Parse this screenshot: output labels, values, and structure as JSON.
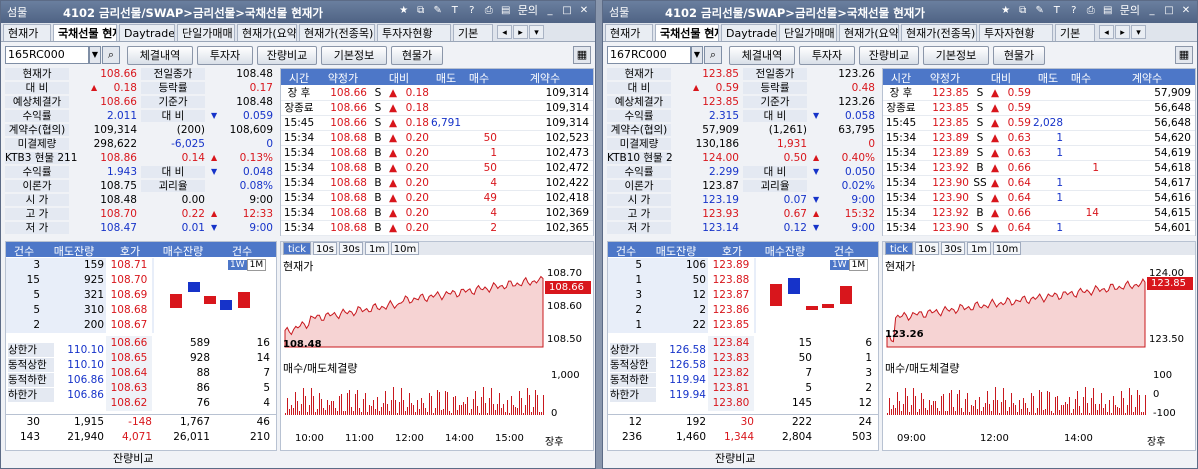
{
  "windows": [
    {
      "title": "4102 금리선물/SWAP>금리선물>국채선물 현재가",
      "logo": "섬물",
      "menu": "문의",
      "tabs": [
        "현재가",
        "국채선물 현재가",
        "Daytrade",
        "단일가매매",
        "현재가(요약)",
        "현재가(전종목)",
        "투자자현황",
        "기본"
      ],
      "code": "165RC000",
      "buttons": [
        "체결내역",
        "투자자",
        "잔량비교",
        "기본정보",
        "현물가"
      ],
      "info": [
        {
          "l": "현재가",
          "v": "108.66",
          "l2": "전일종가",
          "v2": "108.48",
          "c": "red"
        },
        {
          "l": "대  비",
          "arr": "▲",
          "v": "0.18",
          "l2": "등락률",
          "v2": "0.17",
          "c": "red",
          "c2": "red"
        },
        {
          "l": "예상체결가",
          "v": "108.66",
          "l2": "기준가",
          "v2": "108.48",
          "c": "red"
        },
        {
          "l": "수익률",
          "v": "2.011",
          "l2": "대  비",
          "arr2": "▼",
          "v2": "0.059",
          "c": "blue",
          "c2": "blue"
        },
        {
          "l": "계약수(협의)",
          "v": "109,314",
          "l2": "(200)",
          "v2": "108,609"
        },
        {
          "l": "미결제량",
          "v": "298,622",
          "l2": "-6,025",
          "v2": "0",
          "c2": "blue"
        },
        {
          "l": "KTB3 현물 211",
          "v": "108.86",
          "arr2": "▲",
          "l2": "0.14",
          "v2": "0.13%",
          "c": "red",
          "c2": "red"
        },
        {
          "l": "수익률",
          "v": "1.943",
          "l2": "대  비",
          "arr2": "▼",
          "v2": "0.048",
          "c": "blue",
          "c2": "blue"
        },
        {
          "l": "이론가",
          "v": "108.75",
          "l2": "괴리율",
          "v2": "0.08%",
          "c2": "blue"
        },
        {
          "l": "시  가",
          "v": "108.48",
          "l2": "0.00",
          "v2": "9:00"
        },
        {
          "l": "고  가",
          "v": "108.70",
          "arr2": "▲",
          "l2": "0.22",
          "v2": "12:33",
          "c": "red",
          "c2": "red"
        },
        {
          "l": "저  가",
          "v": "108.47",
          "arr2": "▼",
          "l2": "0.01",
          "v2": "9:00",
          "c": "blue",
          "c2": "blue"
        }
      ],
      "tick_head": [
        "시간",
        "약정가",
        "대비",
        "매도",
        "매수",
        "계약수"
      ],
      "ticks": [
        [
          "장 후",
          "108.66",
          "S",
          "▲",
          "0.18",
          "",
          "",
          "109,314"
        ],
        [
          "장종료",
          "108.66",
          "S",
          "▲",
          "0.18",
          "",
          "",
          "109,314"
        ],
        [
          "15:45",
          "108.66",
          "S",
          "▲",
          "0.18",
          "6,791",
          "",
          "109,314"
        ],
        [
          "15:34",
          "108.68",
          "B",
          "▲",
          "0.20",
          "",
          "50",
          "102,523"
        ],
        [
          "15:34",
          "108.68",
          "B",
          "▲",
          "0.20",
          "",
          "1",
          "102,473"
        ],
        [
          "15:34",
          "108.68",
          "B",
          "▲",
          "0.20",
          "",
          "50",
          "102,472"
        ],
        [
          "15:34",
          "108.68",
          "B",
          "▲",
          "0.20",
          "",
          "4",
          "102,422"
        ],
        [
          "15:34",
          "108.68",
          "B",
          "▲",
          "0.20",
          "",
          "49",
          "102,418"
        ],
        [
          "15:34",
          "108.68",
          "B",
          "▲",
          "0.20",
          "",
          "4",
          "102,369"
        ],
        [
          "15:34",
          "108.68",
          "B",
          "▲",
          "0.20",
          "",
          "2",
          "102,365"
        ]
      ],
      "ob_head": [
        "건수",
        "매도잔량",
        "호가",
        "매수잔량",
        "건수"
      ],
      "asks": [
        [
          "3",
          "159",
          "108.71"
        ],
        [
          "15",
          "925",
          "108.70"
        ],
        [
          "5",
          "321",
          "108.69"
        ],
        [
          "5",
          "310",
          "108.68"
        ],
        [
          "2",
          "200",
          "108.67"
        ]
      ],
      "bids": [
        [
          "108.66",
          "589",
          "16"
        ],
        [
          "108.65",
          "928",
          "14"
        ],
        [
          "108.64",
          "88",
          "7"
        ],
        [
          "108.63",
          "86",
          "5"
        ],
        [
          "108.62",
          "76",
          "4"
        ]
      ],
      "limits": [
        [
          "상한가",
          "110.10"
        ],
        [
          "동적상한",
          "110.10"
        ],
        [
          "동적하한",
          "106.86"
        ],
        [
          "하한가",
          "106.86"
        ]
      ],
      "ob_sum1": [
        "30",
        "1,915",
        "-148",
        "1,767",
        "46"
      ],
      "ob_sum2": [
        "143",
        "21,940",
        "4,071",
        "26,011",
        "210"
      ],
      "bottom": "잔량비교",
      "chart": {
        "label": "현재가",
        "vol_label": "매수/매도체결량",
        "last": "108.66",
        "open": "108.48",
        "yticks": [
          "108.70",
          "108.60",
          "108.50"
        ],
        "vticks": [
          "1,000",
          "0"
        ],
        "xticks": [
          "10:00",
          "11:00",
          "12:00",
          "14:00",
          "15:00",
          "장후"
        ],
        "tabs": [
          "tick",
          "10s",
          "30s",
          "1m",
          "10m"
        ],
        "periods": [
          "1W",
          "1M"
        ]
      }
    },
    {
      "title": "4102 금리선물/SWAP>금리선물>국채선물 현재가",
      "logo": "섬물",
      "menu": "문의",
      "tabs": [
        "현재가",
        "국채선물 현재가",
        "Daytrade",
        "단일가매매",
        "현재가(요약)",
        "현재가(전종목)",
        "투자자현황",
        "기본"
      ],
      "code": "167RC000",
      "buttons": [
        "체결내역",
        "투자자",
        "잔량비교",
        "기본정보",
        "현물가"
      ],
      "info": [
        {
          "l": "현재가",
          "v": "123.85",
          "l2": "전일종가",
          "v2": "123.26",
          "c": "red"
        },
        {
          "l": "대  비",
          "arr": "▲",
          "v": "0.59",
          "l2": "등락률",
          "v2": "0.48",
          "c": "red",
          "c2": "red"
        },
        {
          "l": "예상체결가",
          "v": "123.85",
          "l2": "기준가",
          "v2": "123.26",
          "c": "red"
        },
        {
          "l": "수익률",
          "v": "2.315",
          "l2": "대  비",
          "arr2": "▼",
          "v2": "0.058",
          "c": "blue",
          "c2": "blue"
        },
        {
          "l": "계약수(협의)",
          "v": "57,909",
          "l2": "(1,261)",
          "v2": "63,795"
        },
        {
          "l": "미결제량",
          "v": "130,186",
          "l2": "1,931",
          "v2": "0",
          "c2": "red"
        },
        {
          "l": "KTB10 현물 2",
          "v": "124.00",
          "arr2": "▲",
          "l2": "0.50",
          "v2": "0.40%",
          "c": "red",
          "c2": "red"
        },
        {
          "l": "수익률",
          "v": "2.299",
          "l2": "대  비",
          "arr2": "▼",
          "v2": "0.050",
          "c": "blue",
          "c2": "blue"
        },
        {
          "l": "이론가",
          "v": "123.87",
          "l2": "괴리율",
          "v2": "0.02%",
          "c2": "blue"
        },
        {
          "l": "시  가",
          "v": "123.19",
          "arr2": "▼",
          "l2": "0.07",
          "v2": "9:00",
          "c": "blue",
          "c2": "blue"
        },
        {
          "l": "고  가",
          "v": "123.93",
          "arr2": "▲",
          "l2": "0.67",
          "v2": "15:32",
          "c": "red",
          "c2": "red"
        },
        {
          "l": "저  가",
          "v": "123.14",
          "arr2": "▼",
          "l2": "0.12",
          "v2": "9:00",
          "c": "blue",
          "c2": "blue"
        }
      ],
      "tick_head": [
        "시간",
        "약정가",
        "대비",
        "매도",
        "매수",
        "계약수"
      ],
      "ticks": [
        [
          "장 후",
          "123.85",
          "S",
          "▲",
          "0.59",
          "",
          "",
          "57,909"
        ],
        [
          "장종료",
          "123.85",
          "S",
          "▲",
          "0.59",
          "",
          "",
          "56,648"
        ],
        [
          "15:45",
          "123.85",
          "S",
          "▲",
          "0.59",
          "2,028",
          "",
          "56,648"
        ],
        [
          "15:34",
          "123.89",
          "S",
          "▲",
          "0.63",
          "1",
          "",
          "54,620"
        ],
        [
          "15:34",
          "123.89",
          "S",
          "▲",
          "0.63",
          "1",
          "",
          "54,619"
        ],
        [
          "15:34",
          "123.92",
          "B",
          "▲",
          "0.66",
          "",
          "1",
          "54,618"
        ],
        [
          "15:34",
          "123.90",
          "SS",
          "▲",
          "0.64",
          "1",
          "",
          "54,617"
        ],
        [
          "15:34",
          "123.90",
          "S",
          "▲",
          "0.64",
          "1",
          "",
          "54,616"
        ],
        [
          "15:34",
          "123.92",
          "B",
          "▲",
          "0.66",
          "",
          "14",
          "54,615"
        ],
        [
          "15:34",
          "123.90",
          "S",
          "▲",
          "0.64",
          "1",
          "",
          "54,601"
        ]
      ],
      "ob_head": [
        "건수",
        "매도잔량",
        "호가",
        "매수잔량",
        "건수"
      ],
      "asks": [
        [
          "5",
          "106",
          "123.89"
        ],
        [
          "1",
          "50",
          "123.88"
        ],
        [
          "3",
          "12",
          "123.87"
        ],
        [
          "2",
          "2",
          "123.86"
        ],
        [
          "1",
          "22",
          "123.85"
        ]
      ],
      "bids": [
        [
          "123.84",
          "15",
          "6"
        ],
        [
          "123.83",
          "50",
          "1"
        ],
        [
          "123.82",
          "7",
          "3"
        ],
        [
          "123.81",
          "5",
          "2"
        ],
        [
          "123.80",
          "145",
          "12"
        ]
      ],
      "limits": [
        [
          "상한가",
          "126.58"
        ],
        [
          "동적상한",
          "126.58"
        ],
        [
          "동적하한",
          "119.94"
        ],
        [
          "하한가",
          "119.94"
        ]
      ],
      "ob_sum1": [
        "12",
        "192",
        "30",
        "222",
        "24"
      ],
      "ob_sum2": [
        "236",
        "1,460",
        "1,344",
        "2,804",
        "503"
      ],
      "bottom": "잔량비교",
      "chart": {
        "label": "현재가",
        "vol_label": "매수/매도체결량",
        "last": "123.85",
        "open": "123.26",
        "yticks": [
          "124.00",
          "123.50"
        ],
        "vticks": [
          "100",
          "0",
          "-100"
        ],
        "xticks": [
          "09:00",
          "12:00",
          "14:00",
          "장후"
        ],
        "tabs": [
          "tick",
          "10s",
          "30s",
          "1m",
          "10m"
        ],
        "periods": [
          "1W",
          "1M"
        ]
      }
    }
  ],
  "colors": {
    "up": "#d8161c",
    "down": "#1633c9",
    "header": "#4d77c8"
  }
}
